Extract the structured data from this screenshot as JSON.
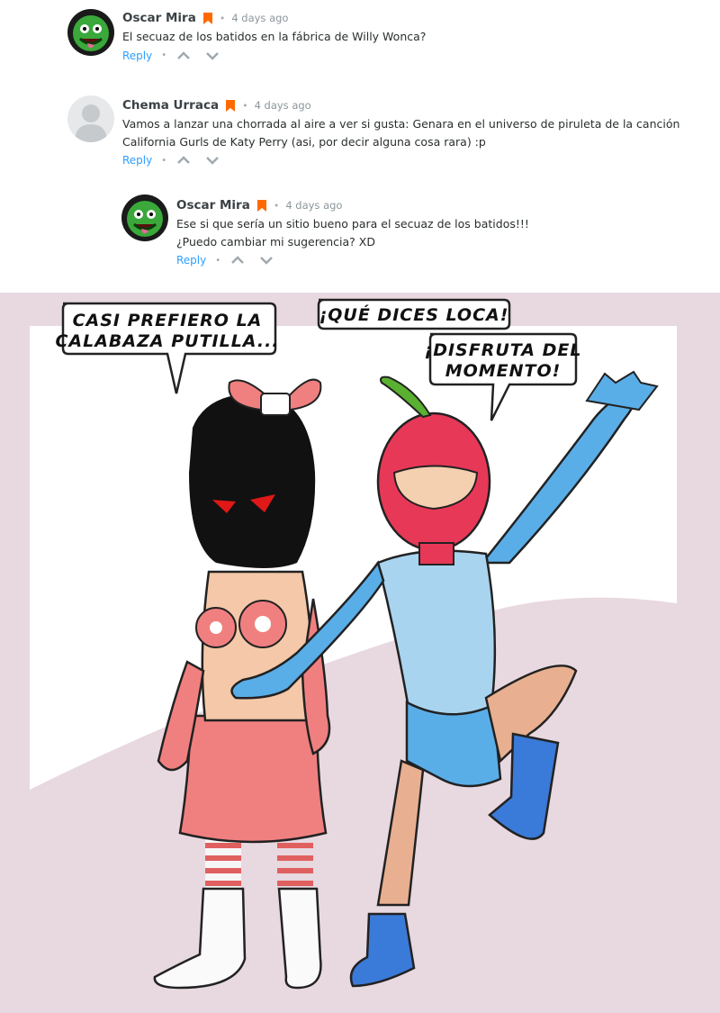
{
  "comments": [
    {
      "author": "Oscar Mira",
      "time": "4 days ago",
      "lines": [
        "El secuaz de los batidos en la fábrica de Willy Wonca?"
      ],
      "reply_label": "Reply",
      "avatar": "green-creature-avatar"
    },
    {
      "author": "Chema Urraca",
      "time": "4 days ago",
      "lines": [
        "Vamos a lanzar una chorrada al aire a ver si gusta: Genara en el universo de piruleta de la canción",
        "California Gurls de Katy Perry (asi, por decir alguna cosa rara) :p"
      ],
      "reply_label": "Reply",
      "avatar": "default-user-avatar"
    },
    {
      "author": "Oscar Mira",
      "time": "4 days ago",
      "lines": [
        "Ese si que sería un sitio bueno para el secuaz de los batidos!!!",
        "¿Puedo cambiar mi sugerencia? XD"
      ],
      "reply_label": "Reply",
      "avatar": "green-creature-avatar"
    }
  ],
  "comic": {
    "bubbles": [
      {
        "lines": [
          "CASI PREFIERO LA",
          "CALABAZA PUTILLA..."
        ]
      },
      {
        "lines": [
          "¡QUÉ DICES LOCA!"
        ]
      },
      {
        "lines": [
          "¡DISFRUTA DEL",
          "MOMENTO!"
        ]
      }
    ]
  },
  "colors": {
    "accent": "#2e9fff",
    "badge": "#ff6a00",
    "comic_background": "#e8d8e0"
  }
}
